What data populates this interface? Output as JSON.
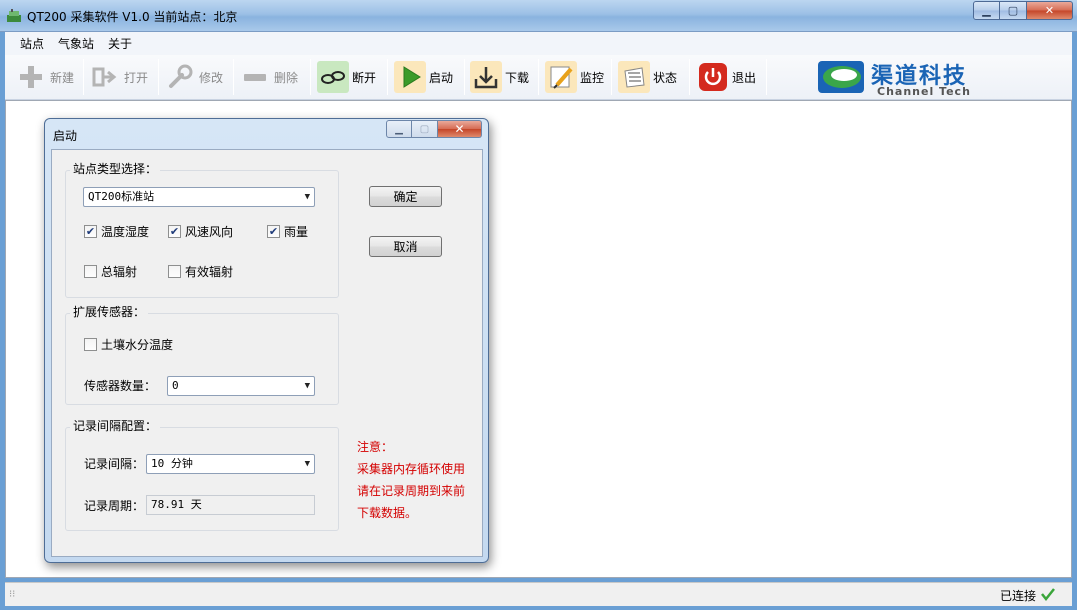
{
  "window": {
    "title": "QT200 采集软件 V1.0  当前站点：北京"
  },
  "menu": [
    "站点",
    "气象站",
    "关于"
  ],
  "toolbar": {
    "new": "新建",
    "open": "打开",
    "edit": "修改",
    "delete": "删除",
    "disconnect": "断开",
    "start": "启动",
    "download": "下载",
    "monitor": "监控",
    "status": "状态",
    "exit": "退出"
  },
  "logo": {
    "cn": "渠道科技",
    "en": "Channel Tech"
  },
  "dialog": {
    "title": "启动",
    "station_group": {
      "label": "站点类型选择：",
      "type_value": "QT200标准站",
      "checkboxes": [
        {
          "label": "温度湿度",
          "checked": true
        },
        {
          "label": "风速风向",
          "checked": true
        },
        {
          "label": "雨量",
          "checked": true
        },
        {
          "label": "总辐射",
          "checked": false
        },
        {
          "label": "有效辐射",
          "checked": false
        }
      ]
    },
    "ext_group": {
      "label": "扩展传感器：",
      "soil_label": "土壤水分温度",
      "soil_checked": false,
      "count_label": "传感器数量：",
      "count_value": "0"
    },
    "record_group": {
      "label": "记录间隔配置：",
      "interval_label": "记录间隔：",
      "interval_value": "10 分钟",
      "period_label": "记录周期：",
      "period_value": "78.91 天"
    },
    "ok": "确定",
    "cancel": "取消",
    "note": [
      "注意：",
      "采集器内存循环使用",
      "请在记录周期到来前",
      "下载数据。"
    ]
  },
  "statusbar": {
    "text": "已连接"
  },
  "colors": {
    "note": "#d40000",
    "logo_blue": "#1a64b5",
    "logo_green": "#3aa64a"
  },
  "icons": [
    "app-icon",
    "plus-icon",
    "open-arrow-icon",
    "wrench-icon",
    "minus-icon",
    "link-icon",
    "play-icon",
    "download-icon",
    "pencil-icon",
    "list-icon",
    "power-icon",
    "check-icon"
  ]
}
